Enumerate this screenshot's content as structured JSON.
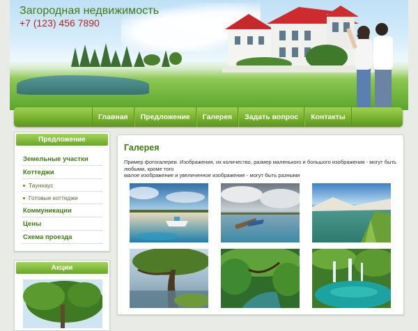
{
  "header": {
    "title": "Загородная недвижимость",
    "phone": "+7 (123) 456 7890"
  },
  "nav": {
    "items": [
      "Главная",
      "Предложение",
      "Галерея",
      "Задать вопрос",
      "Контакты"
    ]
  },
  "sidebar": {
    "offer_title": "Предложение",
    "menu": [
      {
        "label": "Земельные участки",
        "sub": false
      },
      {
        "label": "Коттеджи",
        "sub": false
      },
      {
        "label": "Таунхаус",
        "sub": true
      },
      {
        "label": "Готовые коттеджи",
        "sub": true
      },
      {
        "label": "Коммуникации",
        "sub": false
      },
      {
        "label": "Цены",
        "sub": false
      },
      {
        "label": "Схема проезда",
        "sub": false
      }
    ],
    "promo_title": "Акции"
  },
  "content": {
    "title": "Галерея",
    "description_line1": "Пример фотогалереи. Изображения, их количество, размер маленького и большого изображения - могут быть любыми, кроме того",
    "description_line2": "малое изображение и увеличенное изображение - могут быть разными",
    "gallery": [
      {
        "name": "lake-boat-sunset"
      },
      {
        "name": "pier-boat-clouds"
      },
      {
        "name": "coast-grass-lake"
      },
      {
        "name": "tree-over-lake"
      },
      {
        "name": "forest-river"
      },
      {
        "name": "waterfall-pool"
      }
    ]
  },
  "colors": {
    "accent_green": "#3e7a14",
    "nav_green": "#77b22e",
    "phone_red": "#b0211f"
  }
}
